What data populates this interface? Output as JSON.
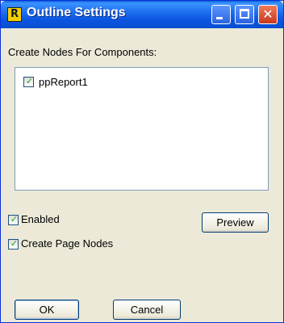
{
  "window": {
    "app_icon_letter": "R",
    "title": "Outline Settings"
  },
  "main": {
    "components_label": "Create Nodes For Components:",
    "components": [
      {
        "label": "ppReport1",
        "checked": true
      }
    ]
  },
  "options": {
    "enabled_label": "Enabled",
    "enabled_checked": true,
    "create_page_nodes_label": "Create Page Nodes",
    "create_page_nodes_checked": true
  },
  "buttons": {
    "preview": "Preview",
    "ok": "OK",
    "cancel": "Cancel"
  },
  "icons": {
    "check": "✓",
    "close": "✕"
  },
  "colors": {
    "titlebar": "#0b55e0",
    "dialog_bg": "#ece9d8",
    "close_button": "#c5381b",
    "checkmark": "#21a121"
  }
}
